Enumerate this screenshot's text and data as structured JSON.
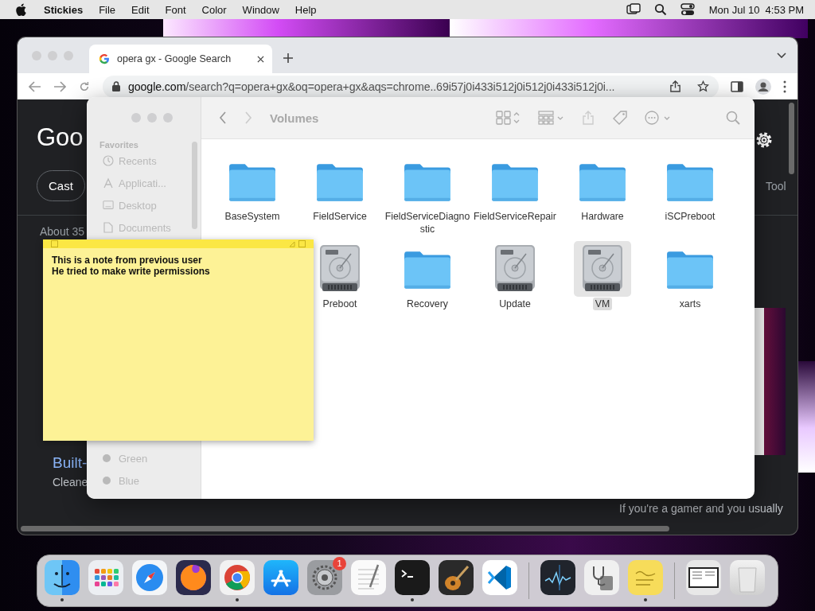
{
  "menu_bar": {
    "app_name": "Stickies",
    "menus": [
      "File",
      "Edit",
      "Font",
      "Color",
      "Window",
      "Help"
    ],
    "clock": "Mon Jul 10  4:53 PM"
  },
  "browser": {
    "tab": {
      "title": "opera gx - Google Search"
    },
    "address": {
      "domain": "google.com",
      "path": "/search?q=opera+gx&oq=opera+gx&aqs=chrome..69i57j0i433i512j0i512j0i433i512j0i..."
    },
    "page": {
      "logo": "Goo",
      "chip": "Cast",
      "tools": "Tool",
      "results_count": "About 35",
      "result_title": "Built-",
      "result_snippet": "Cleane",
      "snippet": "If you're a gamer and you usually"
    }
  },
  "finder": {
    "title": "Volumes",
    "sidebar": {
      "heading": "Favorites",
      "items": [
        {
          "label": "Recents",
          "kind": "recents"
        },
        {
          "label": "Applicati...",
          "kind": "applications"
        },
        {
          "label": "Desktop",
          "kind": "desktop"
        },
        {
          "label": "Documents",
          "kind": "documents"
        }
      ],
      "tags": [
        {
          "label": "Green"
        },
        {
          "label": "Blue"
        }
      ]
    },
    "items": [
      {
        "name": "BaseSystem",
        "kind": "folder",
        "selected": false
      },
      {
        "name": "FieldService",
        "kind": "folder",
        "selected": false
      },
      {
        "name": "FieldServiceDiagnostic",
        "kind": "folder",
        "selected": false
      },
      {
        "name": "FieldServiceRepair",
        "kind": "folder",
        "selected": false
      },
      {
        "name": "Hardware",
        "kind": "folder",
        "selected": false
      },
      {
        "name": "iSCPreboot",
        "kind": "folder",
        "selected": false
      },
      {
        "name": "Preboot",
        "kind": "drive",
        "selected": false
      },
      {
        "name": "Recovery",
        "kind": "folder",
        "selected": false
      },
      {
        "name": "Update",
        "kind": "drive",
        "selected": false
      },
      {
        "name": "VM",
        "kind": "drive",
        "selected": true
      },
      {
        "name": "xarts",
        "kind": "folder",
        "selected": false
      }
    ]
  },
  "sticky": {
    "text": "This is a note from previous user\nHe tried to make write permissions"
  },
  "dock": {
    "apps": [
      {
        "kind": "finder",
        "running": true
      },
      {
        "kind": "launchpad",
        "running": false
      },
      {
        "kind": "safari",
        "running": false
      },
      {
        "kind": "firefox",
        "running": false
      },
      {
        "kind": "chrome",
        "running": true
      },
      {
        "kind": "appstore",
        "running": false
      },
      {
        "kind": "settings",
        "running": false,
        "badge": "1"
      },
      {
        "kind": "textedit",
        "running": false
      },
      {
        "kind": "terminal",
        "running": true
      },
      {
        "kind": "guitar",
        "running": false
      },
      {
        "kind": "code",
        "running": false
      },
      {
        "kind": "separator"
      },
      {
        "kind": "activity",
        "running": false
      },
      {
        "kind": "disk",
        "running": false
      },
      {
        "kind": "stickies",
        "running": true
      },
      {
        "kind": "separator"
      },
      {
        "kind": "screenshot",
        "running": false
      },
      {
        "kind": "trash",
        "running": false
      }
    ]
  }
}
